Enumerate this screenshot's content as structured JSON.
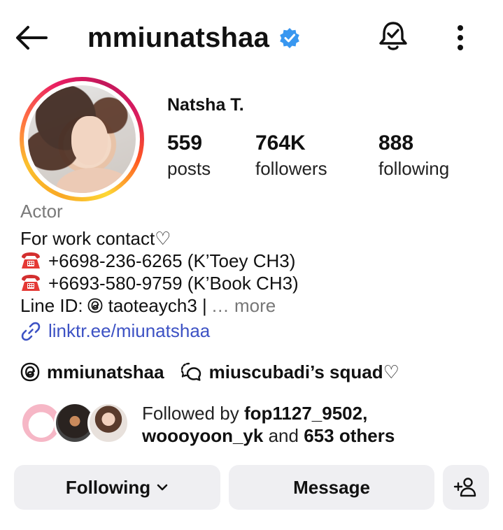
{
  "header": {
    "username": "mmiunatshaa",
    "verified": true
  },
  "profile": {
    "display_name": "Natsha T.",
    "stats": [
      {
        "value": "559",
        "label": "posts"
      },
      {
        "value": "764K",
        "label": "followers"
      },
      {
        "value": "888",
        "label": "following"
      }
    ],
    "category": "Actor",
    "bio": {
      "line1": "For work contact♡",
      "line2": "+6698-236-6265 (K’Toey CH3)",
      "line3": "+6693-580-9759 (K’Book CH3)",
      "line4_prefix": "Line ID:",
      "line4_handle": "taoteaych3 |",
      "more": "… more"
    },
    "link": "linktr.ee/miunatshaa"
  },
  "chips": {
    "threads": "mmiunatshaa",
    "channel": "miuscubadi’s squad♡"
  },
  "followed_by": {
    "prefix": "Followed by",
    "user1": "fop1127_9502,",
    "user2": "woooyoon_yk",
    "middle": "and",
    "others": "653 others"
  },
  "actions": {
    "following": "Following",
    "message": "Message"
  },
  "colors": {
    "verified": "#3897f0",
    "link": "#3d52c4",
    "button_bg": "#efeff2",
    "secondary_text": "#7a7a7a"
  }
}
